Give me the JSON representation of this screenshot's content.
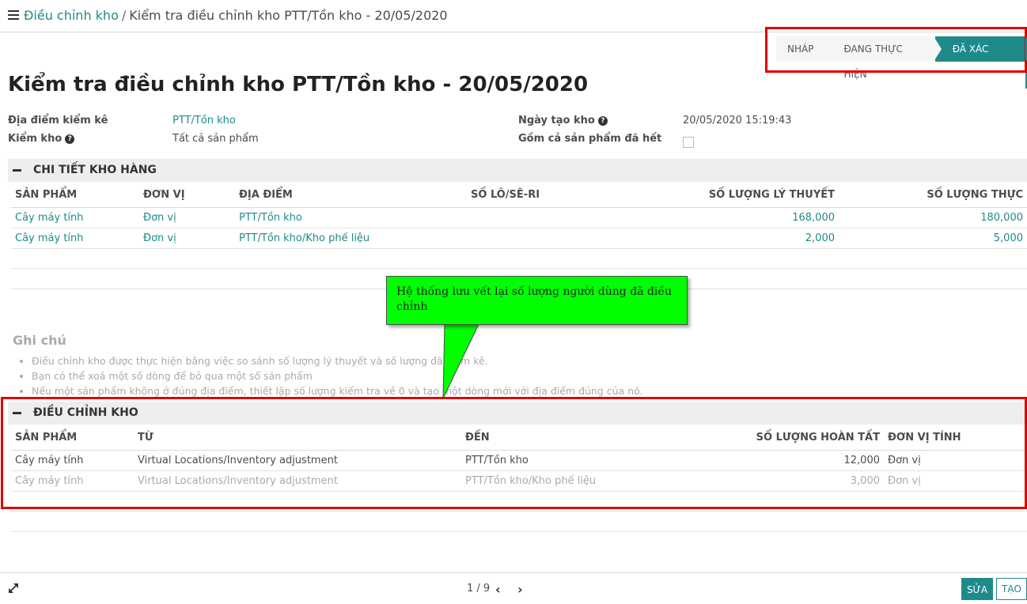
{
  "breadcrumb": {
    "parent": "Điều chỉnh kho",
    "separator": "/",
    "current": "Kiểm tra điều chỉnh kho PTT/Tồn kho - 20/05/2020"
  },
  "status": {
    "stages": [
      "NHÁP",
      "ĐANG THỰC HIỆN",
      "ĐÃ XÁC NHẬN"
    ],
    "active": "ĐÃ XÁC NHẬN"
  },
  "title": "Kiểm tra điều chỉnh kho PTT/Tồn kho - 20/05/2020",
  "fields": {
    "location_label": "Địa điểm kiểm kê",
    "location_value": "PTT/Tồn kho",
    "inventory_label": "Kiểm kho",
    "inventory_value": "Tất cả sản phẩm",
    "date_label": "Ngày tạo kho",
    "date_value": "20/05/2020 15:19:43",
    "exhausted_label": "Gồm cả sản phẩm đã hết",
    "exhausted_checked": false,
    "help_glyph": "?"
  },
  "details_section": {
    "title": "CHI TIẾT KHO HÀNG",
    "columns": [
      "SẢN PHẨM",
      "ĐƠN VỊ",
      "ĐỊA ĐIỂM",
      "SỐ LÔ/SÊ-RI",
      "SỐ LƯỢNG LÝ THUYẾT",
      "SỐ LƯỢNG THỰC"
    ],
    "rows": [
      {
        "product": "Cây máy tính",
        "unit": "Đơn vị",
        "location": "PTT/Tồn kho",
        "lot": "",
        "theoretical": "168,000",
        "real": "180,000"
      },
      {
        "product": "Cây máy tính",
        "unit": "Đơn vị",
        "location": "PTT/Tồn kho/Kho phế liệu",
        "lot": "",
        "theoretical": "2,000",
        "real": "5,000"
      }
    ]
  },
  "notes": {
    "title": "Ghi chú",
    "items": [
      "Điều chỉnh kho được thực hiện bằng việc so sánh số lượng lý thuyết và số lượng đã kiểm kê.",
      "Bạn có thể xoá một số dòng để bỏ qua một số sản phẩm",
      "Nếu một sản phẩm không ở đúng địa điểm, thiết lập số lượng kiểm tra về 0 và tạo một dòng mới với địa điểm đúng của nó."
    ]
  },
  "callout": {
    "text": "Hệ thống lưu vết lại số lượng người dùng đã điều chỉnh",
    "color": "#00ff00"
  },
  "adjust_section": {
    "title": "ĐIỀU CHỈNH KHO",
    "columns": [
      "SẢN PHẨM",
      "TỪ",
      "ĐẾN",
      "SỐ LƯỢNG HOÀN TẤT",
      "ĐƠN VỊ TÍNH"
    ],
    "rows": [
      {
        "product": "Cây máy tính",
        "from": "Virtual Locations/Inventory adjustment",
        "to": "PTT/Tồn kho",
        "qty": "12,000",
        "uom": "Đơn vị"
      },
      {
        "product": "Cây máy tính",
        "from": "Virtual Locations/Inventory adjustment",
        "to": "PTT/Tồn kho/Kho phế liệu",
        "qty": "3,000",
        "uom": "Đơn vị"
      }
    ]
  },
  "footer": {
    "pager": "1 / 9",
    "edit_label": "SỬA",
    "create_label": "TẠO"
  },
  "colors": {
    "accent": "#1f8a8a",
    "highlight_red": "#e00000"
  },
  "icons": [
    "menu-icon",
    "help-icon",
    "collapse-icon",
    "expand-icon",
    "chevron-left-icon",
    "chevron-right-icon"
  ]
}
